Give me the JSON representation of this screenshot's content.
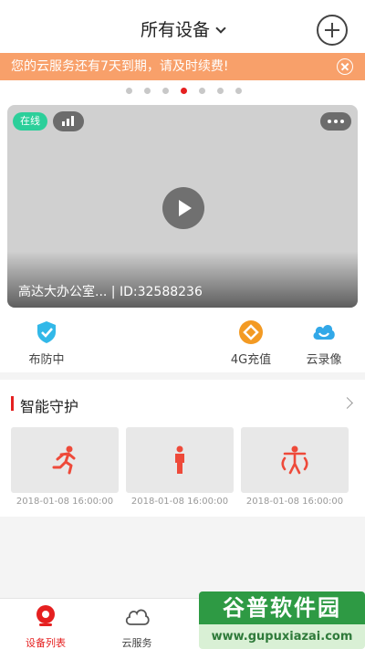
{
  "header": {
    "title": "所有设备",
    "add_icon": "plus-circle-icon"
  },
  "notice": {
    "text": "您的云服务还有7天到期，请及时续费!",
    "background": "#f8a06a",
    "close_icon": "close-circle-icon"
  },
  "carousel": {
    "count": 7,
    "active_index": 3,
    "active_color": "#e52020"
  },
  "device": {
    "status": "在线",
    "status_color": "#2ccf9a",
    "signal_icon": "signal-icon",
    "more_icon": "more-icon",
    "play_icon": "play-icon",
    "label": "高达大办公室... | ID:32588236"
  },
  "actions": [
    {
      "label": "布防中",
      "icon": "shield-check-icon",
      "color": "#32b8e8"
    },
    {
      "label": "4G充值",
      "icon": "recharge-icon",
      "color": "#f39a23"
    },
    {
      "label": "云录像",
      "icon": "cloud-record-icon",
      "color": "#32a8e8"
    }
  ],
  "guard": {
    "title": "智能守护",
    "accent": "#e52020",
    "items": [
      {
        "icon": "running-person-icon",
        "time": "2018-01-08 16:00:00"
      },
      {
        "icon": "standing-person-icon",
        "time": "2018-01-08 16:00:00"
      },
      {
        "icon": "person-waving-icon",
        "time": "2018-01-08 16:00:00"
      }
    ]
  },
  "tabbar": [
    {
      "label": "设备列表",
      "icon": "camera-icon",
      "active": true
    },
    {
      "label": "云服务",
      "icon": "cloud-icon",
      "active": false
    }
  ],
  "watermark": {
    "title": "谷普软件园",
    "url": "www.gupuxiazai.com"
  }
}
